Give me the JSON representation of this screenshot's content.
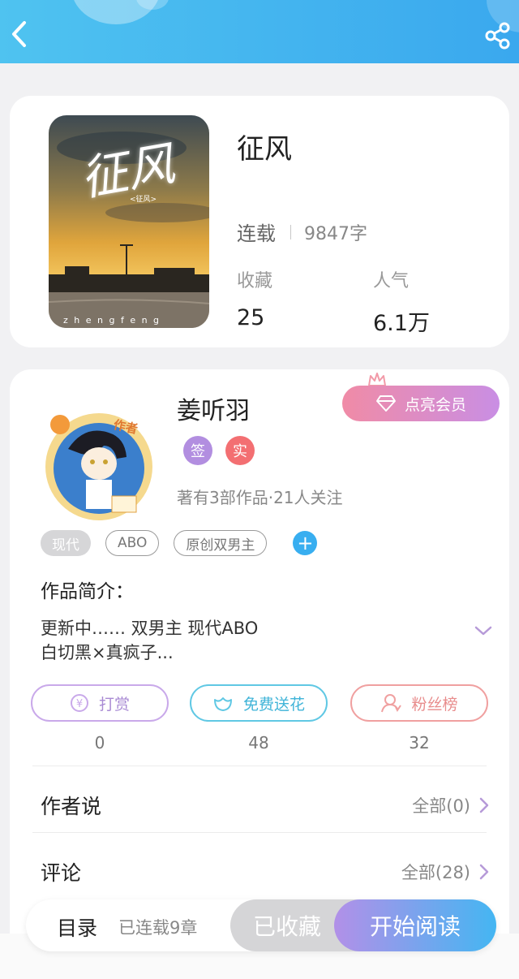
{
  "book": {
    "title": "征风",
    "status": "连载",
    "word_count": "9847字",
    "favorites_label": "收藏",
    "favorites_value": "25",
    "popularity_label": "人气",
    "popularity_value": "6.1万",
    "cover_title": "征风",
    "cover_subtitle": "<征风>",
    "cover_footer": "z h e n g f e n g"
  },
  "author": {
    "name": "姜听羽",
    "vip_label": "点亮会员",
    "badge_sign": "签",
    "badge_real": "实",
    "meta": "著有3部作品·21人关注",
    "avatar_tag": "作者"
  },
  "tags": [
    {
      "label": "现代"
    },
    {
      "label": "ABO"
    },
    {
      "label": "原创双男主"
    }
  ],
  "intro": {
    "title": "作品简介：",
    "line1": "更新中…… 双男主 现代ABO",
    "line2": "白切黑×真疯子..."
  },
  "actions": [
    {
      "label": "打赏",
      "count": "0"
    },
    {
      "label": "免费送花",
      "count": "48"
    },
    {
      "label": "粉丝榜",
      "count": "32"
    }
  ],
  "sections": [
    {
      "title": "作者说",
      "more": "全部(0)"
    },
    {
      "title": "评论",
      "more": "全部(28)"
    }
  ],
  "bottom": {
    "toc": "目录",
    "chapters": "已连载9章",
    "favorited": "已收藏",
    "read": "开始阅读"
  },
  "colors": {
    "header": "#3aa8ee",
    "accent_purple": "#b28ee0",
    "accent_blue": "#38aef0",
    "accent_red": "#f36f72"
  }
}
